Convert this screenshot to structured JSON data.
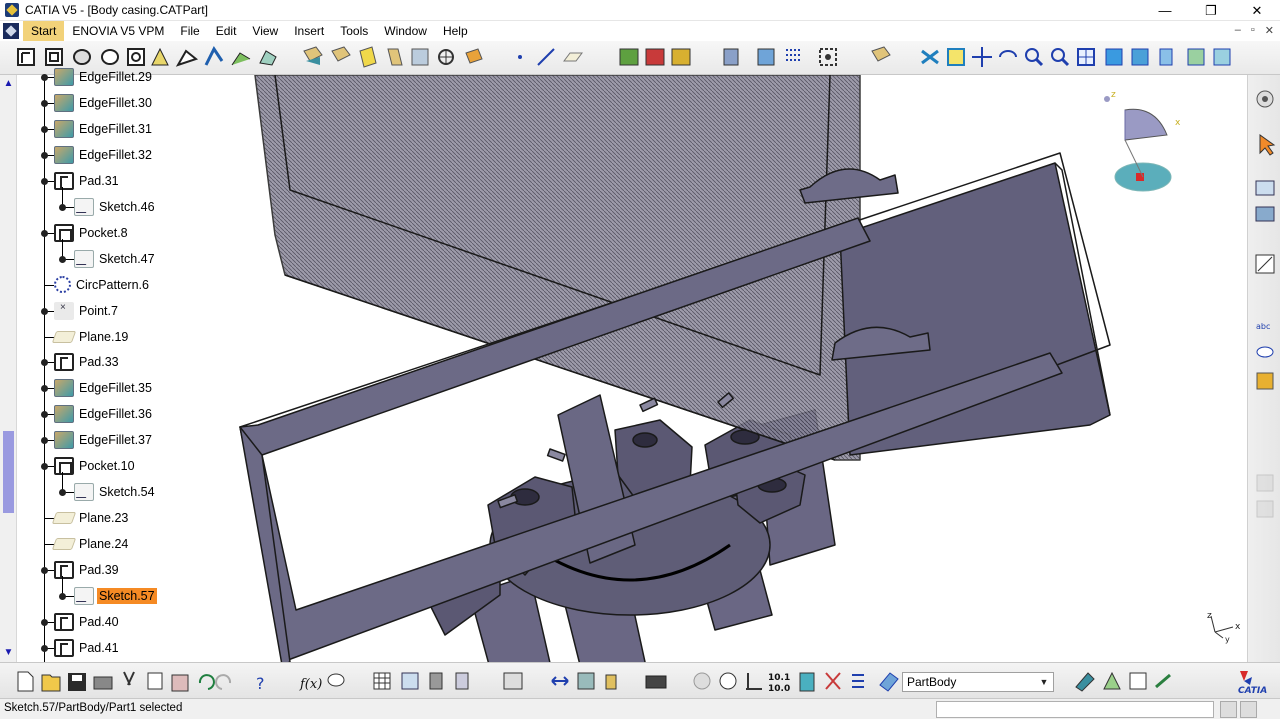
{
  "window": {
    "title": "CATIA V5 - [Body casing.CATPart]",
    "minimize": "—",
    "maximize": "❐",
    "close": "✕"
  },
  "menu": {
    "items": [
      "Start",
      "ENOVIA V5 VPM",
      "File",
      "Edit",
      "View",
      "Insert",
      "Tools",
      "Window",
      "Help"
    ],
    "mdi_controls": [
      "–",
      "▫",
      "✕"
    ]
  },
  "tree": {
    "items": [
      {
        "label": "EdgeFillet.29",
        "icon": "edge-fillet-icon"
      },
      {
        "label": "EdgeFillet.30",
        "icon": "edge-fillet-icon"
      },
      {
        "label": "EdgeFillet.31",
        "icon": "edge-fillet-icon"
      },
      {
        "label": "EdgeFillet.32",
        "icon": "edge-fillet-icon"
      },
      {
        "label": "Pad.31",
        "icon": "pad-icon"
      },
      {
        "label": "Sketch.46",
        "icon": "sketch-icon"
      },
      {
        "label": "Pocket.8",
        "icon": "pocket-icon"
      },
      {
        "label": "Sketch.47",
        "icon": "sketch-icon"
      },
      {
        "label": "CircPattern.6",
        "icon": "circ-pattern-icon"
      },
      {
        "label": "Point.7",
        "icon": "point-icon"
      },
      {
        "label": "Plane.19",
        "icon": "plane-icon"
      },
      {
        "label": "Pad.33",
        "icon": "pad-icon"
      },
      {
        "label": "EdgeFillet.35",
        "icon": "edge-fillet-icon"
      },
      {
        "label": "EdgeFillet.36",
        "icon": "edge-fillet-icon"
      },
      {
        "label": "EdgeFillet.37",
        "icon": "edge-fillet-icon"
      },
      {
        "label": "Pocket.10",
        "icon": "pocket-icon"
      },
      {
        "label": "Sketch.54",
        "icon": "sketch-icon"
      },
      {
        "label": "Plane.23",
        "icon": "plane-icon"
      },
      {
        "label": "Plane.24",
        "icon": "plane-icon"
      },
      {
        "label": "Pad.39",
        "icon": "pad-icon"
      },
      {
        "label": "Sketch.57",
        "icon": "sketch-icon",
        "selected": true
      },
      {
        "label": "Pad.40",
        "icon": "pad-icon"
      },
      {
        "label": "Pad.41",
        "icon": "pad-icon"
      }
    ]
  },
  "compass": {
    "axis_x": "x",
    "axis_z": "z"
  },
  "axes_triad": {
    "x": "x",
    "y": "y",
    "z": "z"
  },
  "bottom_toolbar": {
    "body_selector_value": "PartBody",
    "scale_top": "10.1",
    "scale_bottom": "10.0",
    "brand": "CATIA"
  },
  "status": {
    "text": "Sketch.57/PartBody/Part1 selected"
  },
  "colors": {
    "selection": "#f58a24",
    "part_face": "#605e78",
    "part_edge": "#1a1a1a",
    "scrollbar_thumb": "#9a9ae0"
  }
}
